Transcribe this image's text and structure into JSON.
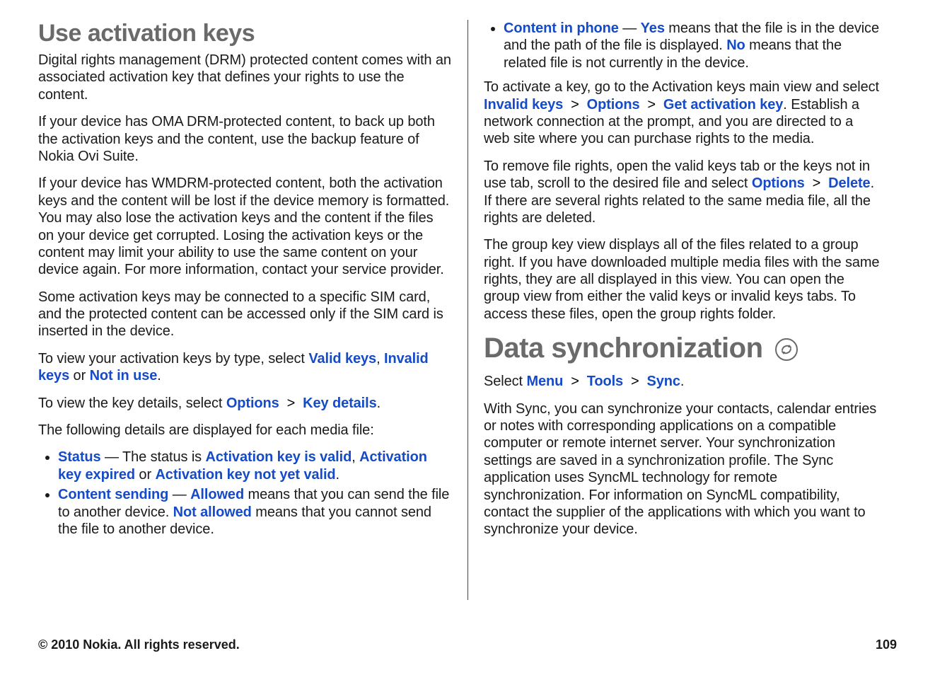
{
  "left": {
    "h1": "Use activation keys",
    "p1": "Digital rights management (DRM) protected content comes with an associated activation key that defines your rights to use the content.",
    "p2": "If your device has OMA DRM-protected content, to back up both the activation keys and the content, use the backup feature of Nokia Ovi Suite.",
    "p3": "If your device has WMDRM-protected content, both the activation keys and the content will be lost if the device memory is formatted. You may also lose the activation keys and the content if the files on your device get corrupted. Losing the activation keys or the content may limit your ability to use the same content on your device again. For more information, contact your service provider.",
    "p4": "Some activation keys may be connected to a specific SIM card, and the protected content can be accessed only if the SIM card is inserted in the device.",
    "p5_pre": "To view your activation keys by type, select ",
    "valid_keys": "Valid keys",
    "p5_mid1": ", ",
    "invalid_keys": "Invalid keys",
    "p5_mid2": " or ",
    "not_in_use": "Not in use",
    "p6_pre": "To view the key details, select ",
    "options": "Options",
    "key_details": "Key details",
    "p7": "The following details are displayed for each media file:",
    "li1_label": "Status",
    "li1_mid1": " — The status is ",
    "li1_v1": "Activation key is valid",
    "li1_v2": "Activation key expired",
    "li1_or": " or ",
    "li1_v3": "Activation key not yet valid",
    "li2_label": "Content sending",
    "li2_mid1": " — ",
    "li2_allowed": "Allowed",
    "li2_mid2": " means that you can send the file to another device. ",
    "li2_notallowed": "Not allowed",
    "li2_mid3": " means that you cannot send the file to another device."
  },
  "right": {
    "li3_label": "Content in phone",
    "li3_mid1": " — ",
    "li3_yes": "Yes",
    "li3_mid2": " means that the file is in the device and the path of the file is displayed. ",
    "li3_no": "No",
    "li3_mid3": " means that the related file is not currently in the device.",
    "p1_pre": "To activate a key, go to the Activation keys main view and select ",
    "invalid_keys": "Invalid keys",
    "options": "Options",
    "get_activation_key": "Get activation key",
    "p1_post": ". Establish a network connection at the prompt, and you are directed to a web site where you can purchase rights to the media.",
    "p2_pre": "To remove file rights, open the valid keys tab or the keys not in use tab, scroll to the desired file and select ",
    "delete": "Delete",
    "p2_post": ". If there are several rights related to the same media file, all the rights are deleted.",
    "p3": "The group key view displays all of the files related to a group right. If you have downloaded multiple media files with the same rights, they are all displayed in this view. You can open the group view from either the valid keys or invalid keys tabs. To access these files, open the group rights folder.",
    "h1": "Data synchronization",
    "p4_pre": "Select ",
    "menu": "Menu",
    "tools": "Tools",
    "sync": "Sync",
    "p5": "With Sync, you can synchronize your contacts, calendar entries or notes with corresponding applications on a compatible computer or remote internet server. Your synchronization settings are saved in a synchronization profile. The Sync application uses SyncML technology for remote synchronization. For information on SyncML compatibility, contact the supplier of the applications with which you want to synchronize your device."
  },
  "footer": {
    "copyright": "© 2010 Nokia. All rights reserved.",
    "page": "109"
  }
}
